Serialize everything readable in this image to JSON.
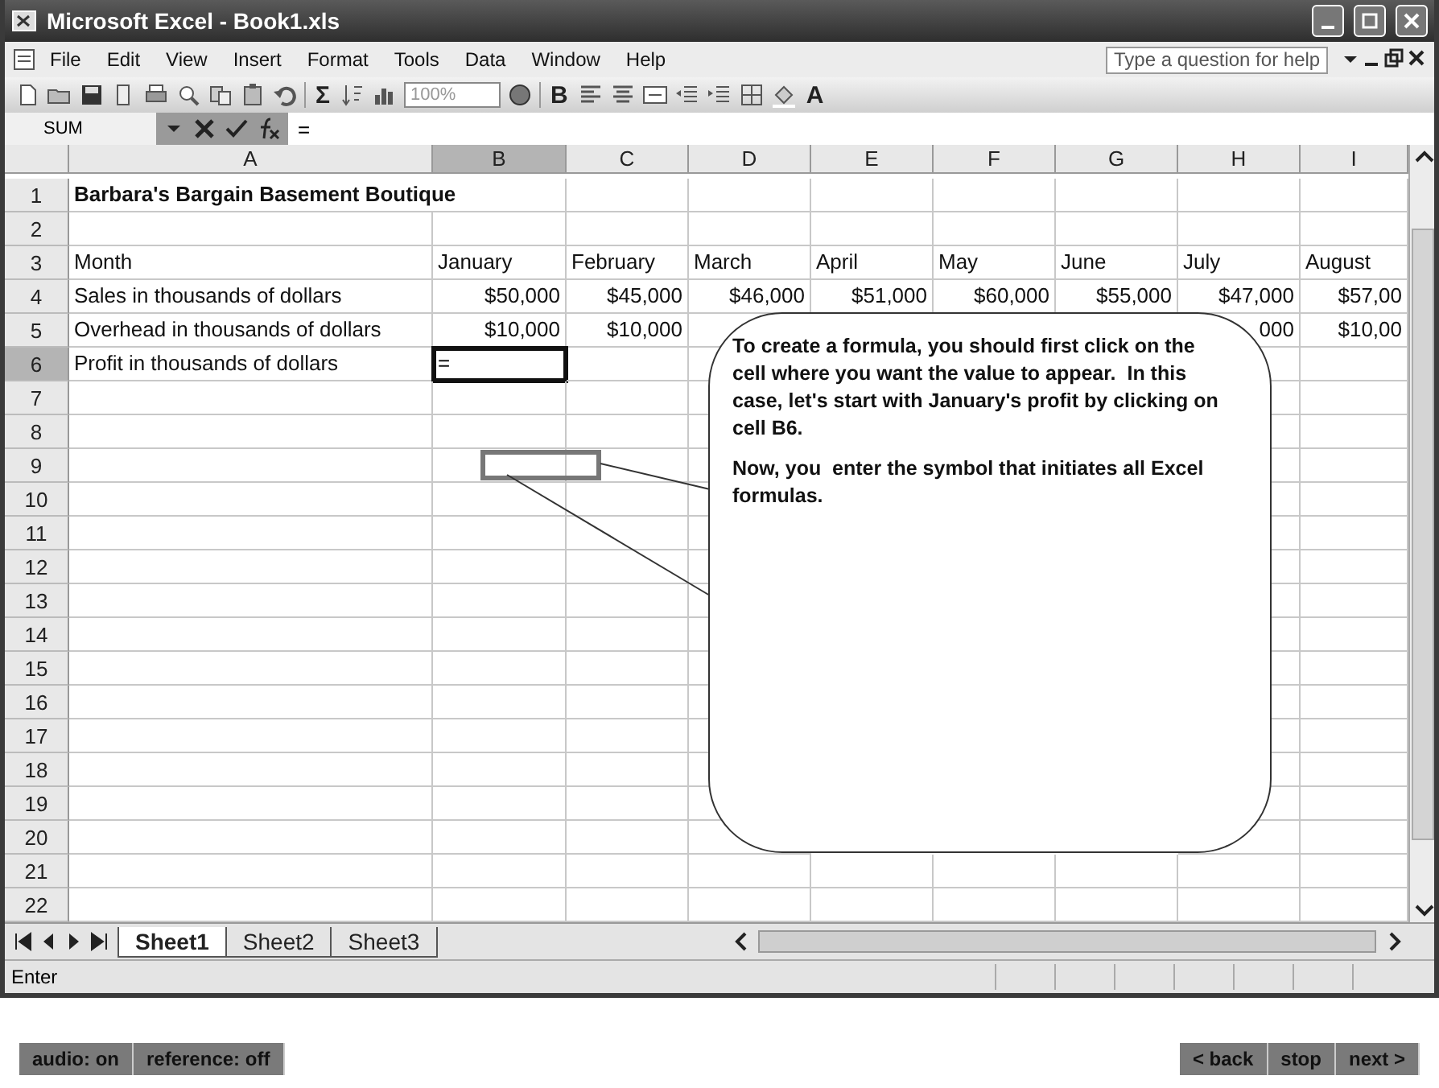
{
  "window": {
    "title": "Microsoft Excel - Book1.xls"
  },
  "menu": [
    "File",
    "Edit",
    "View",
    "Insert",
    "Format",
    "Tools",
    "Data",
    "Window",
    "Help"
  ],
  "help_box": {
    "placeholder": "Type a question for help"
  },
  "toolbar": {
    "sum_glyph": "Σ",
    "zoom": "100%",
    "bold_glyph": "B",
    "font_color_glyph": "A"
  },
  "formula_bar": {
    "name_box": "SUM",
    "formula": "="
  },
  "columns": [
    {
      "label": "A",
      "selected": false
    },
    {
      "label": "B",
      "selected": true
    },
    {
      "label": "C",
      "selected": false
    },
    {
      "label": "D",
      "selected": false
    },
    {
      "label": "E",
      "selected": false
    },
    {
      "label": "F",
      "selected": false
    },
    {
      "label": "G",
      "selected": false
    },
    {
      "label": "H",
      "selected": false
    },
    {
      "label": "I",
      "selected": false
    }
  ],
  "rows": [
    {
      "label": "1",
      "selected": false,
      "kind": "title",
      "cells": {
        "A": "Barbara's Bargain Basement Boutique"
      }
    },
    {
      "label": "2",
      "selected": false
    },
    {
      "label": "3",
      "selected": false,
      "kind": "text",
      "cells": {
        "A": "Month",
        "B": "January",
        "C": "February",
        "D": "March",
        "E": "April",
        "F": "May",
        "G": "June",
        "H": "July",
        "I": "August"
      }
    },
    {
      "label": "4",
      "selected": false,
      "kind": "money",
      "cells": {
        "A": "Sales in thousands of dollars",
        "B": "$50,000",
        "C": "$45,000",
        "D": "$46,000",
        "E": "$51,000",
        "F": "$60,000",
        "G": "$55,000",
        "H": "$47,000",
        "I": "$57,00"
      }
    },
    {
      "label": "5",
      "selected": false,
      "kind": "money",
      "cells": {
        "A": "Overhead in thousands of dollars",
        "B": "$10,000",
        "C": "$10,000",
        "H": "000",
        "I": "$10,00"
      }
    },
    {
      "label": "6",
      "selected": true,
      "kind": "text",
      "cells": {
        "A": "Profit in thousands of dollars",
        "B": "="
      }
    },
    {
      "label": "7",
      "selected": false
    },
    {
      "label": "8",
      "selected": false
    },
    {
      "label": "9",
      "selected": false
    },
    {
      "label": "10",
      "selected": false
    },
    {
      "label": "11",
      "selected": false
    },
    {
      "label": "12",
      "selected": false
    },
    {
      "label": "13",
      "selected": false
    },
    {
      "label": "14",
      "selected": false
    },
    {
      "label": "15",
      "selected": false
    },
    {
      "label": "16",
      "selected": false
    },
    {
      "label": "17",
      "selected": false
    },
    {
      "label": "18",
      "selected": false
    },
    {
      "label": "19",
      "selected": false
    },
    {
      "label": "20",
      "selected": false
    },
    {
      "label": "21",
      "selected": false
    },
    {
      "label": "22",
      "selected": false
    }
  ],
  "callout": {
    "paragraphs": [
      "To create a formula, you should first click on the cell where you want the value to appear.  In this case, let's start with January's profit by clicking on cell B6.",
      "Now, you  enter the symbol that initiates all Excel formulas."
    ]
  },
  "sheet_tabs": [
    {
      "label": "Sheet1",
      "selected": true
    },
    {
      "label": "Sheet2",
      "selected": false
    },
    {
      "label": "Sheet3",
      "selected": false
    }
  ],
  "status_bar": {
    "mode": "Enter"
  },
  "player": {
    "left_buttons": [
      "audio: on",
      "reference: off"
    ],
    "right_buttons": [
      "< back",
      "stop",
      "next >"
    ]
  }
}
